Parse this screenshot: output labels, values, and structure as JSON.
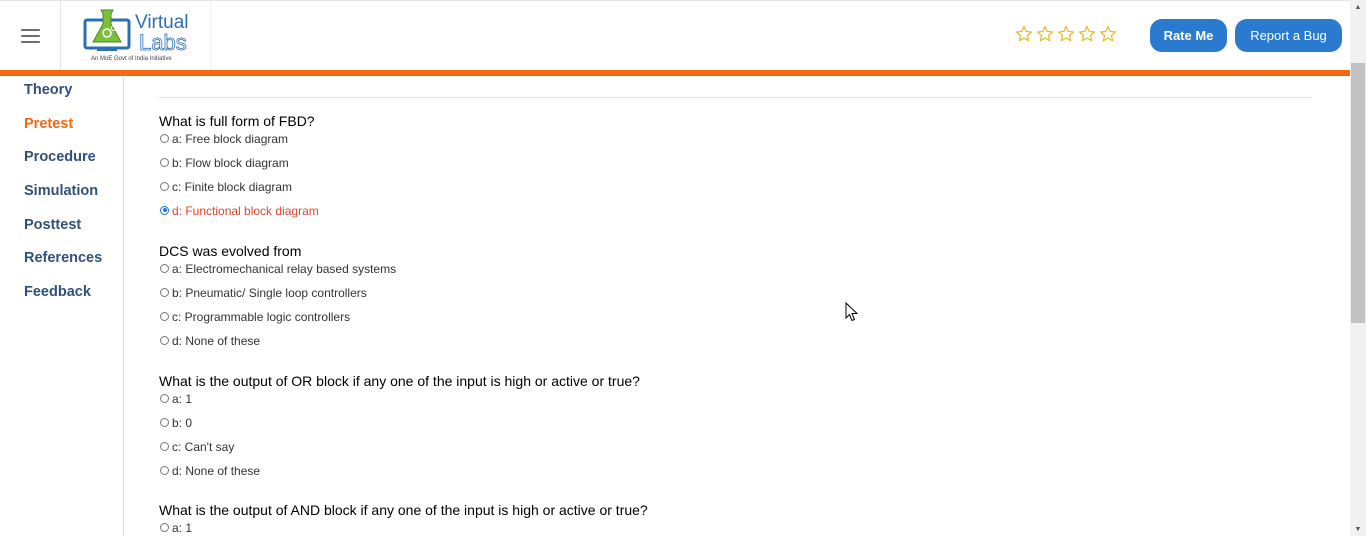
{
  "header": {
    "logo_line1": "Virtual",
    "logo_line2": "Labs",
    "logo_tagline": "An MoE Govt of India Initiative",
    "rating_stars": 5,
    "rate_label": "Rate Me",
    "bug_label": "Report a Bug"
  },
  "colors": {
    "accent_orange": "#f26a0f",
    "button_blue": "#2a7bd0",
    "star_yellow": "#e8b923",
    "nav_blue": "#31507a",
    "selected_red": "#e0452b"
  },
  "sidebar": {
    "items": [
      {
        "label": "Theory",
        "active": false
      },
      {
        "label": "Pretest",
        "active": true
      },
      {
        "label": "Procedure",
        "active": false
      },
      {
        "label": "Simulation",
        "active": false
      },
      {
        "label": "Posttest",
        "active": false
      },
      {
        "label": "References",
        "active": false
      },
      {
        "label": "Feedback",
        "active": false
      }
    ]
  },
  "main": {
    "questions": [
      {
        "text": "What is full form of FBD?",
        "options": [
          "a: Free block diagram",
          "b: Flow block diagram",
          "c: Finite block diagram",
          "d: Functional block diagram"
        ],
        "selected": 3
      },
      {
        "text": "DCS was evolved from",
        "options": [
          "a: Electromechanical relay based systems",
          "b: Pneumatic/ Single loop controllers",
          "c: Programmable logic controllers",
          "d: None of these"
        ],
        "selected": -1
      },
      {
        "text": "What is the output of OR block if any one of the input is high or active or true?",
        "options": [
          "a: 1",
          "b: 0",
          "c: Can't say",
          "d: None of these"
        ],
        "selected": -1
      },
      {
        "text": "What is the output of AND block if any one of the input is high or active or true?",
        "options": [
          "a: 1"
        ],
        "selected": -1
      }
    ]
  },
  "icons": {
    "menu": "hamburger-icon",
    "star": "star-outline-icon",
    "cursor": "mouse-pointer-icon"
  }
}
